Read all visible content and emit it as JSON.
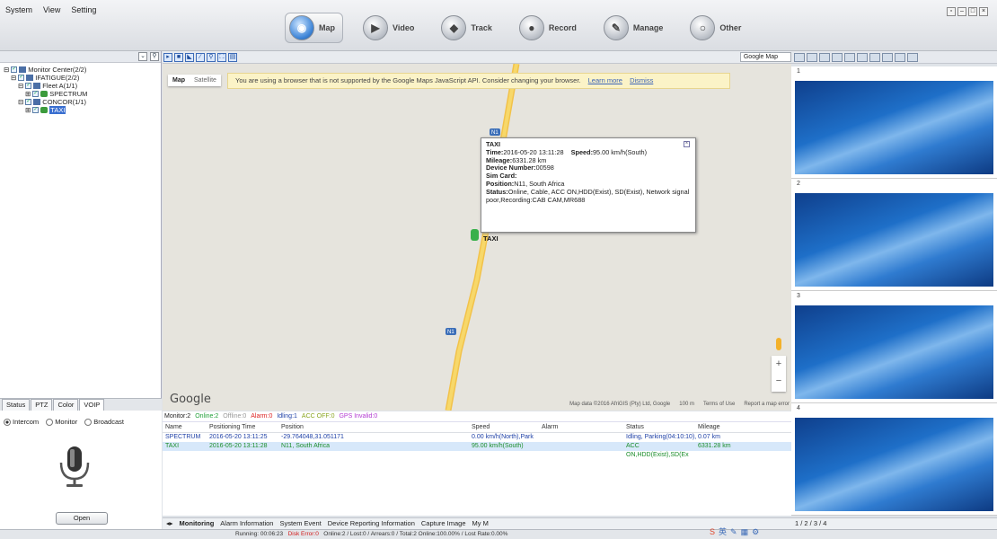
{
  "menu": [
    "System",
    "View",
    "Setting"
  ],
  "nav": [
    {
      "label": "Map",
      "icon": "globe-icon",
      "active": true
    },
    {
      "label": "Video",
      "icon": "video-camera-icon",
      "active": false
    },
    {
      "label": "Track",
      "icon": "track-icon",
      "active": false
    },
    {
      "label": "Record",
      "icon": "record-icon",
      "active": false
    },
    {
      "label": "Manage",
      "icon": "manage-icon",
      "active": false
    },
    {
      "label": "Other",
      "icon": "other-icon",
      "active": false
    }
  ],
  "tree": [
    {
      "label": "Monitor Center(2/2)",
      "depth": 0
    },
    {
      "label": "IFATIGUE(2/2)",
      "depth": 1
    },
    {
      "label": "Fleet A(1/1)",
      "depth": 2
    },
    {
      "label": "SPECTRUM",
      "depth": 3
    },
    {
      "label": "CONCOR(1/1)",
      "depth": 2
    },
    {
      "label": "TAXI",
      "depth": 3
    }
  ],
  "left_tabs": [
    "Status",
    "PTZ",
    "Color",
    "VOIP"
  ],
  "voip": {
    "modes": [
      "Intercom",
      "Monitor",
      "Broadcast"
    ],
    "open_label": "Open"
  },
  "map": {
    "type_select": "Google Map",
    "tabs": [
      "Map",
      "Satellite"
    ],
    "warning": "You are using a browser that is not supported by the Google Maps JavaScript API. Consider changing your browser.",
    "learn_more": "Learn more",
    "dismiss": "Dismiss",
    "road_label": "N1",
    "google_logo": "Google",
    "attribution": "Map data ©2016 AfriGIS (Pty) Ltd, Google",
    "scale": "100 m",
    "terms": "Terms of Use",
    "report": "Report a map error",
    "marker_label": "TAXI",
    "info": {
      "title": "TAXI",
      "time_label": "Time:",
      "time_value": "2016-05-20 13:11:28",
      "speed_label": "Speed:",
      "speed_value": "95.00 km/h(South)",
      "mileage_label": "Mileage:",
      "mileage_value": "6331.28 km",
      "device_label": "Device Number:",
      "device_value": "00598",
      "sim_label": "Sim Card:",
      "position_label": "Position:",
      "position_value": "N11, South Africa",
      "status_label": "Status:",
      "status_value": "Online, Cable, ACC ON,HDD(Exist), SD(Exist), Network signal poor,Recording:CAB CAM,MR688"
    }
  },
  "monitor_stats": {
    "monitor": "Monitor:2",
    "online": "Online:2",
    "offline": "Offline:0",
    "alarm": "Alarm:0",
    "idling": "Idling:1",
    "acc_off": "ACC OFF:0",
    "gps_invalid": "GPS Invalid:0"
  },
  "table": {
    "headers": [
      "Name",
      "Positioning Time",
      "Position",
      "Speed",
      "Alarm",
      "Status",
      "Mileage"
    ],
    "rows": [
      [
        "SPECTRUM",
        "2016-05-20 13:11:25",
        "-29.764048,31.051171",
        "0.00 km/h(North),Park",
        "",
        "Idling, Parking(04:10:10),",
        "0.07 km"
      ],
      [
        "TAXI",
        "2016-05-20 13:11:28",
        "N11, South Africa",
        "95.00 km/h(South)",
        "",
        "ACC ON,HDD(Exist),SD(Ex",
        "6331.28 km"
      ]
    ]
  },
  "bottom_tabs": [
    "Monitoring",
    "Alarm Information",
    "System Event",
    "Device Reporting Information",
    "Capture Image",
    "My M"
  ],
  "video_cells": [
    "1",
    "2",
    "3",
    "4"
  ],
  "video_pages": "1 / 2 / 3 / 4",
  "status_bar": {
    "running": "Running: 00:06:23",
    "disk_error": "Disk Error:0",
    "rest": "Online:2 / Lost:0 / Arrears:0 / Total:2   Online:100.00% / Lost Rate:0.00%"
  }
}
